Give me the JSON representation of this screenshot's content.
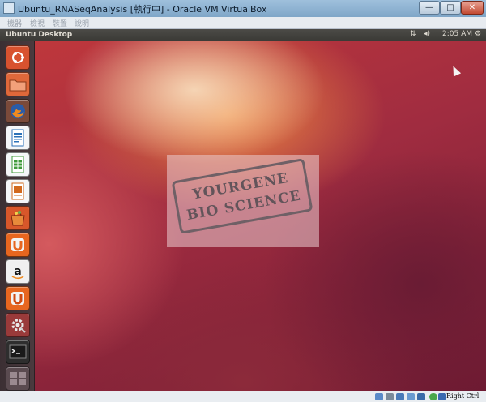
{
  "window": {
    "title": "Ubuntu_RNASeqAnalysis [執行中] - Oracle VM VirtualBox",
    "minimize_glyph": "—",
    "maximize_glyph": "□",
    "close_glyph": "✕"
  },
  "menu": [
    "機器",
    "檢視",
    "裝置",
    "說明"
  ],
  "panel": {
    "title": "Ubuntu Desktop",
    "network_glyph": "⇅",
    "volume_glyph": "◂)",
    "clock": "2:05 AM",
    "gear_glyph": "⚙"
  },
  "launcher": [
    {
      "name": "ubuntu-dash-icon",
      "color": "#d8522f"
    },
    {
      "name": "files-folder-icon",
      "color": "#e0683a"
    },
    {
      "name": "firefox-icon",
      "color": "#e76e1f"
    },
    {
      "name": "libreoffice-writer-icon",
      "color": "#2c72b8"
    },
    {
      "name": "libreoffice-calc-icon",
      "color": "#3f9a3a"
    },
    {
      "name": "libreoffice-impress-icon",
      "color": "#d2691e"
    },
    {
      "name": "software-center-icon",
      "color": "#d8572a"
    },
    {
      "name": "ubuntu-one-icon",
      "color": "#e7661f"
    },
    {
      "name": "amazon-icon",
      "color": "#f0f0f0"
    },
    {
      "name": "ubuntu-one-music-icon",
      "color": "#e7661f"
    },
    {
      "name": "system-settings-icon",
      "color": "#9a3a3a"
    },
    {
      "name": "terminal-icon",
      "color": "#2e2e2e"
    },
    {
      "name": "workspace-switcher-icon",
      "color": "#5a4b50"
    }
  ],
  "watermark": {
    "line1": "YOURGENE",
    "line2": "BIO SCIENCE"
  },
  "statusbar": {
    "host_key": "Right Ctrl"
  }
}
